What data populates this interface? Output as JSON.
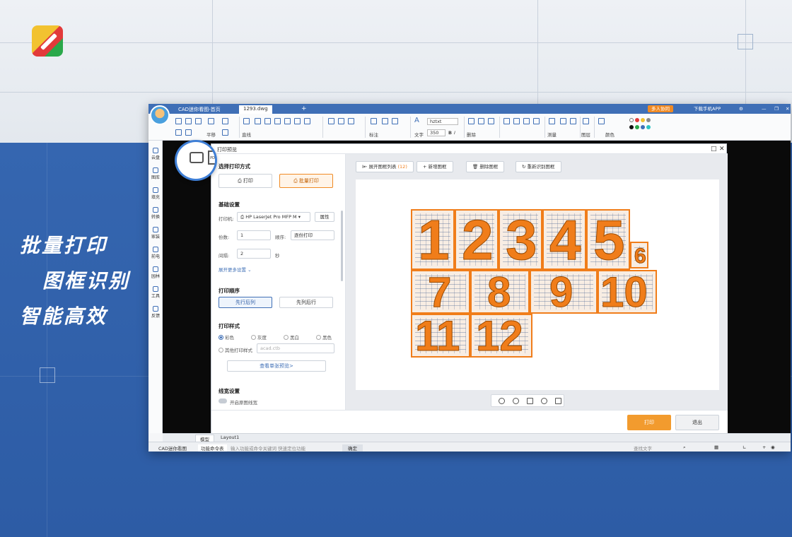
{
  "slogan": {
    "line1": "批量打印",
    "line2": "图框识别",
    "line3": "智能高效"
  },
  "titlebar": {
    "tab_home": "CAD迷你看图-首页",
    "tab_file": "1293.dwg",
    "add_tab": "+",
    "invite": "多人协同",
    "download_app": "下载手机APP"
  },
  "ribbon": {
    "pan": "平移",
    "line": "直线",
    "annotate": "标注",
    "text": "文字",
    "delete": "删除",
    "measure": "测量",
    "layer": "图层",
    "color": "颜色",
    "font_name": "hztxt",
    "font_size": "350",
    "bold": "B",
    "italic": "I"
  },
  "leftbar": [
    "云盘",
    "图库",
    "填充",
    "转换",
    "家装",
    "前电",
    "园林",
    "工具",
    "反馈"
  ],
  "dialog": {
    "title": "打印预览",
    "choose_mode": "选择打印方式",
    "print": "打印",
    "batch_print": "批量打印",
    "basic_settings": "基础设置",
    "printer_label": "打印机:",
    "printer_value": "HP LaserJet Pro MFP M",
    "properties": "属性",
    "copies_label": "份数:",
    "copies_value": "1",
    "order_label": "顺序:",
    "order_value": "逐份打印",
    "interval_label": "间隔:",
    "interval_value": "2",
    "interval_unit": "秒",
    "more_settings": "展开更多设置",
    "print_order": "打印顺序",
    "row_first": "先行后列",
    "col_first": "先列后行",
    "print_style": "打印样式",
    "styles": [
      "彩色",
      "灰度",
      "黑白",
      "黑色"
    ],
    "other_style": "其他打印样式",
    "other_style_value": "acad.ctb",
    "view_single_preview": "查看单张预览>",
    "line_width": "线宽设置",
    "enable_line_width": "开启原图线宽"
  },
  "preview": {
    "expand_list": "展开图框列表",
    "frame_count": "(12)",
    "add_frame": "新增图框",
    "delete_frame": "删除图框",
    "redetect": "重新识别图框",
    "frames": [
      "1",
      "2",
      "3",
      "4",
      "5",
      "6",
      "7",
      "8",
      "9",
      "10",
      "11",
      "12"
    ]
  },
  "footer": {
    "print": "打印",
    "exit": "退出"
  },
  "layout_tabs": {
    "model": "模型",
    "layout1": "Layout1"
  },
  "statusbar": {
    "app_name": "CAD迷你看图",
    "cmd_panel": "功能命令表",
    "hint": "输入功能或命令关键词 快速定位功能",
    "confirm": "确定",
    "find_text": "查找文字"
  },
  "colors": {
    "accent": "#f07d1a",
    "brand_blue": "#3f6fb6",
    "print_btn": "#f29b2e"
  }
}
